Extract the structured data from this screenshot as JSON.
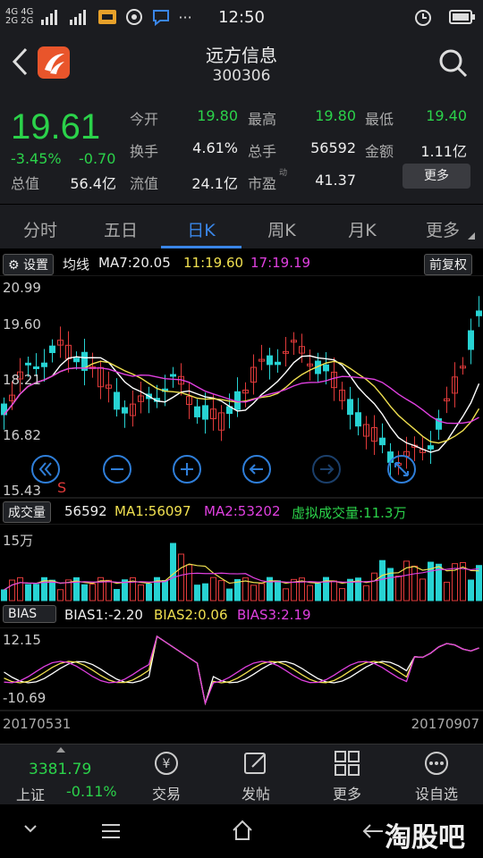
{
  "status_bar": {
    "signal_left": "4G 4G",
    "signal_left2": "2G 2G",
    "time": "12:50",
    "dots": "···"
  },
  "header": {
    "title": "远方信息",
    "code": "300306"
  },
  "quote": {
    "price": "19.61",
    "change_pct": "-3.45%",
    "change_abs": "-0.70",
    "rows": [
      [
        {
          "label": "今开",
          "value": "19.80",
          "color": "green"
        },
        {
          "label": "最高",
          "value": "19.80",
          "color": "green"
        },
        {
          "label": "最低",
          "value": "19.40",
          "color": "green"
        }
      ],
      [
        {
          "label": "换手",
          "value": "4.61%",
          "color": "white"
        },
        {
          "label": "总手",
          "value": "56592",
          "color": "white"
        },
        {
          "label": "金额",
          "value": "1.11亿",
          "color": "white"
        }
      ],
      [
        {
          "label": "流值",
          "value": "24.1亿",
          "color": "white"
        },
        {
          "label": "市盈",
          "value": "41.37",
          "color": "white"
        }
      ]
    ],
    "total_value_label": "总值",
    "total_value": "56.4亿",
    "pe_superscript": "动",
    "more_label": "更多"
  },
  "tabs": [
    "分时",
    "五日",
    "日K",
    "周K",
    "月K",
    "更多"
  ],
  "active_tab": 2,
  "kline": {
    "settings_label": "设置",
    "ma_title": "均线",
    "ma7": "MA7:20.05",
    "ma11": "11:19.60",
    "ma17": "17:19.19",
    "adjust_label": "前复权",
    "y_labels": [
      "20.99",
      "19.60",
      "18.21",
      "16.82",
      "15.43"
    ],
    "s_marker": "S"
  },
  "volume": {
    "label": "成交量",
    "vol": "56592",
    "ma1": "MA1:56097",
    "ma2": "MA2:53202",
    "virtual": "虚拟成交量:11.3万",
    "y_top": "15万"
  },
  "bias": {
    "label": "BIAS",
    "b1": "BIAS1:-2.20",
    "b2": "BIAS2:0.06",
    "b3": "BIAS3:2.19",
    "y_top": "12.15",
    "y_bottom": "-10.69",
    "date_start": "20170531",
    "date_end": "20170907"
  },
  "bottom_nav": {
    "index_value": "3381.79",
    "index_name": "上证",
    "index_change": "-0.11%",
    "items": [
      "交易",
      "发帖",
      "更多",
      "设自选"
    ]
  },
  "watermark": "淘股吧",
  "colors": {
    "up": "#e03a3a",
    "down": "#27d3d3",
    "green": "#2bd24a",
    "accent": "#3a86e8",
    "ma_white": "#ffffff",
    "ma_yellow": "#f0e050",
    "ma_magenta": "#e040e0"
  }
}
